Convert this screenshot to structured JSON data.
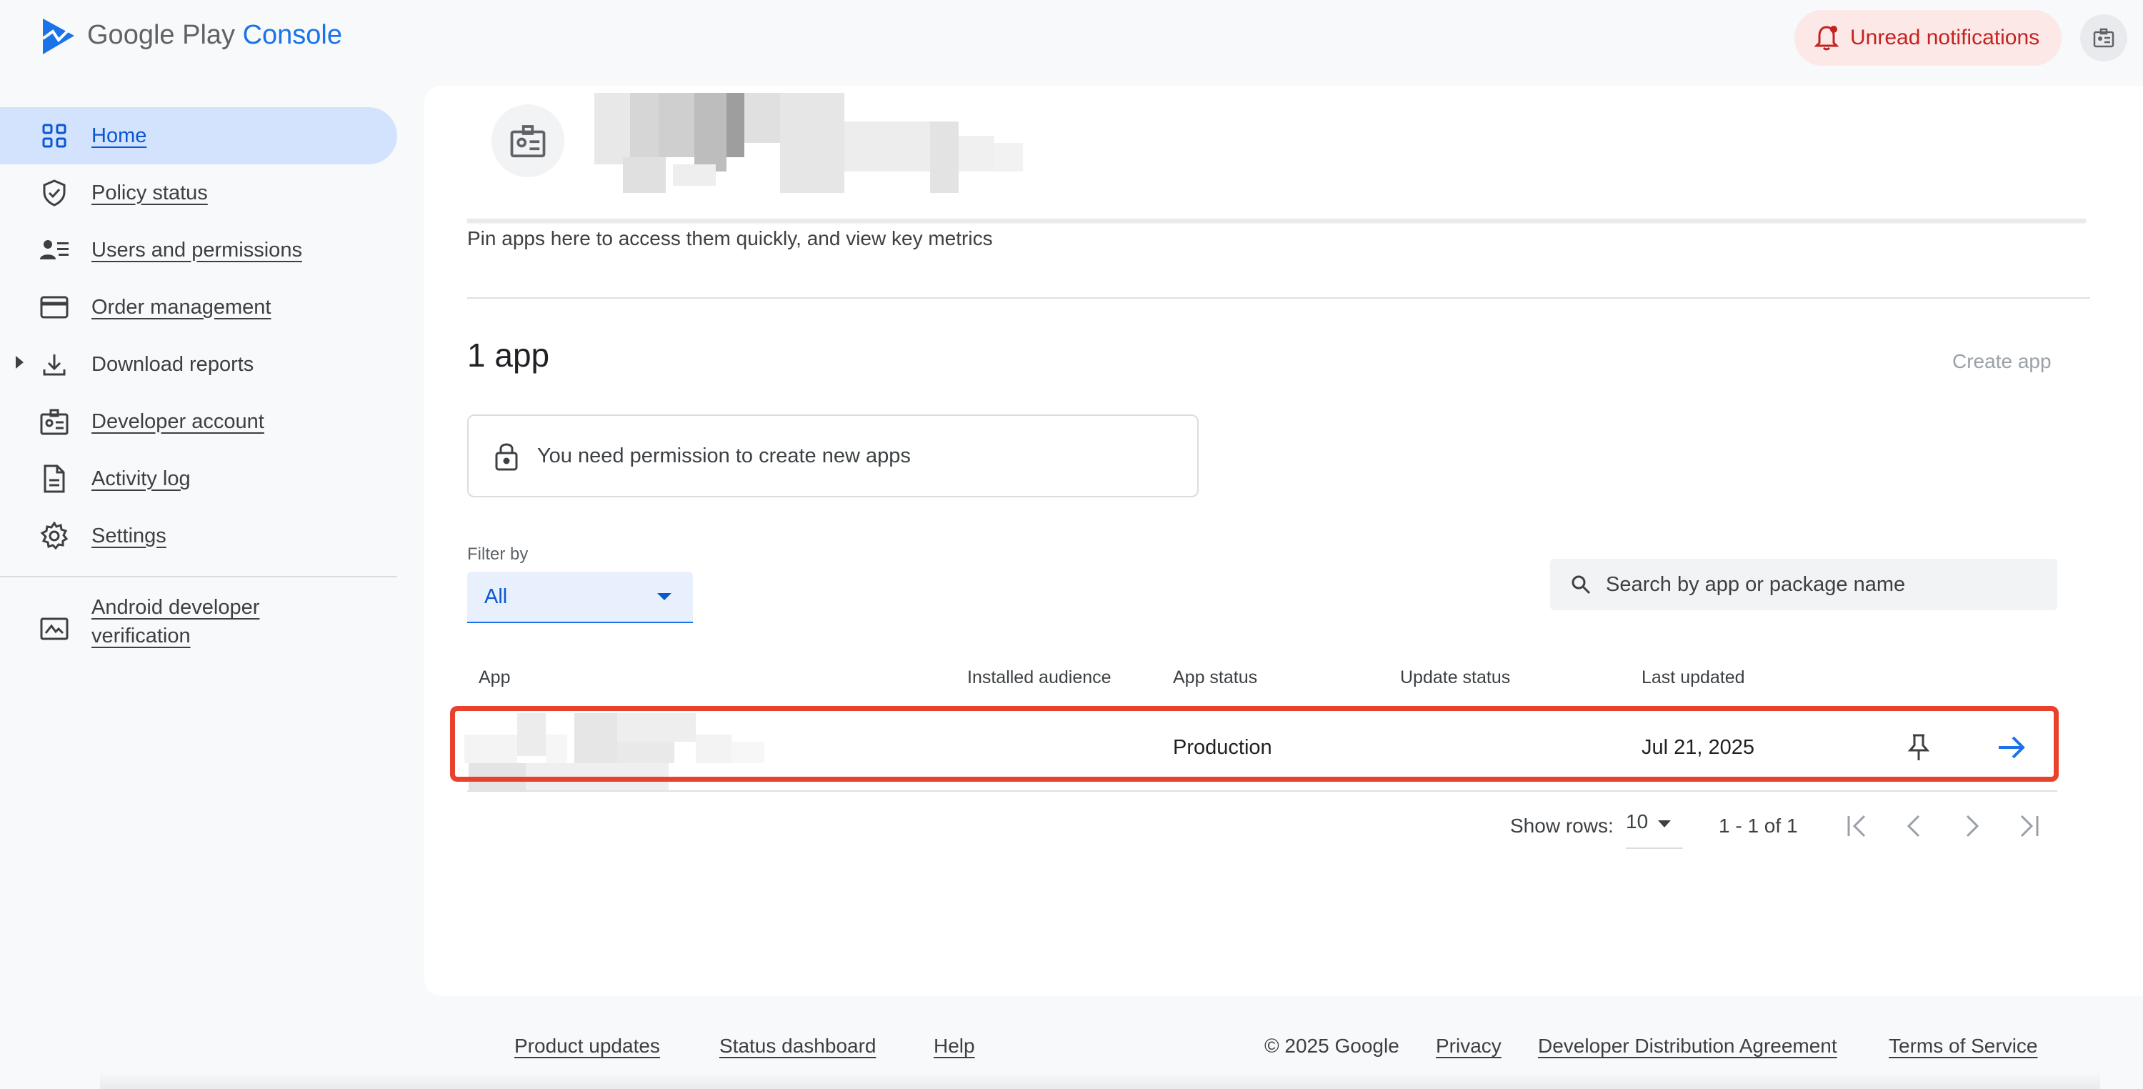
{
  "brand": {
    "name_prefix": "Google Play",
    "name_accent": "Console",
    "accent_color": "#1a73e8"
  },
  "header": {
    "notifications_label": "Unread notifications",
    "notifications_color": "#c5221f"
  },
  "sidebar": {
    "items": [
      {
        "label": "Home",
        "icon": "dashboard-icon",
        "active": true
      },
      {
        "label": "Policy status",
        "icon": "shield-check-icon"
      },
      {
        "label": "Users and permissions",
        "icon": "people-list-icon"
      },
      {
        "label": "Order management",
        "icon": "credit-card-icon"
      },
      {
        "label": "Download reports",
        "icon": "download-icon"
      },
      {
        "label": "Developer account",
        "icon": "badge-icon"
      },
      {
        "label": "Activity log",
        "icon": "document-icon"
      },
      {
        "label": "Settings",
        "icon": "gear-icon"
      }
    ],
    "verification": {
      "line1": "Android developer",
      "line2": "verification",
      "icon": "id-card-icon"
    }
  },
  "main": {
    "pin_hint": "Pin apps here to access them quickly, and view key metrics",
    "apps_count": "1 app",
    "create_app": "Create app",
    "permission_notice": "You need permission to create new apps",
    "filter": {
      "label": "Filter by",
      "value": "All"
    },
    "search": {
      "placeholder": "Search by app or package name"
    },
    "table": {
      "headers": [
        "App",
        "Installed audience",
        "App status",
        "Update status",
        "Last updated"
      ],
      "rows": [
        {
          "app": "",
          "installed_audience": "",
          "app_status": "Production",
          "update_status": "",
          "last_updated": "Jul 21, 2025"
        }
      ]
    },
    "pagination": {
      "show_rows_label": "Show rows:",
      "rows_per_page": "10",
      "range": "1 - 1 of 1"
    }
  },
  "footer": {
    "links": [
      "Product updates",
      "Status dashboard",
      "Help"
    ],
    "copyright": "© 2025 Google",
    "legal_links": [
      "Privacy",
      "Developer Distribution Agreement",
      "Terms of Service"
    ]
  }
}
